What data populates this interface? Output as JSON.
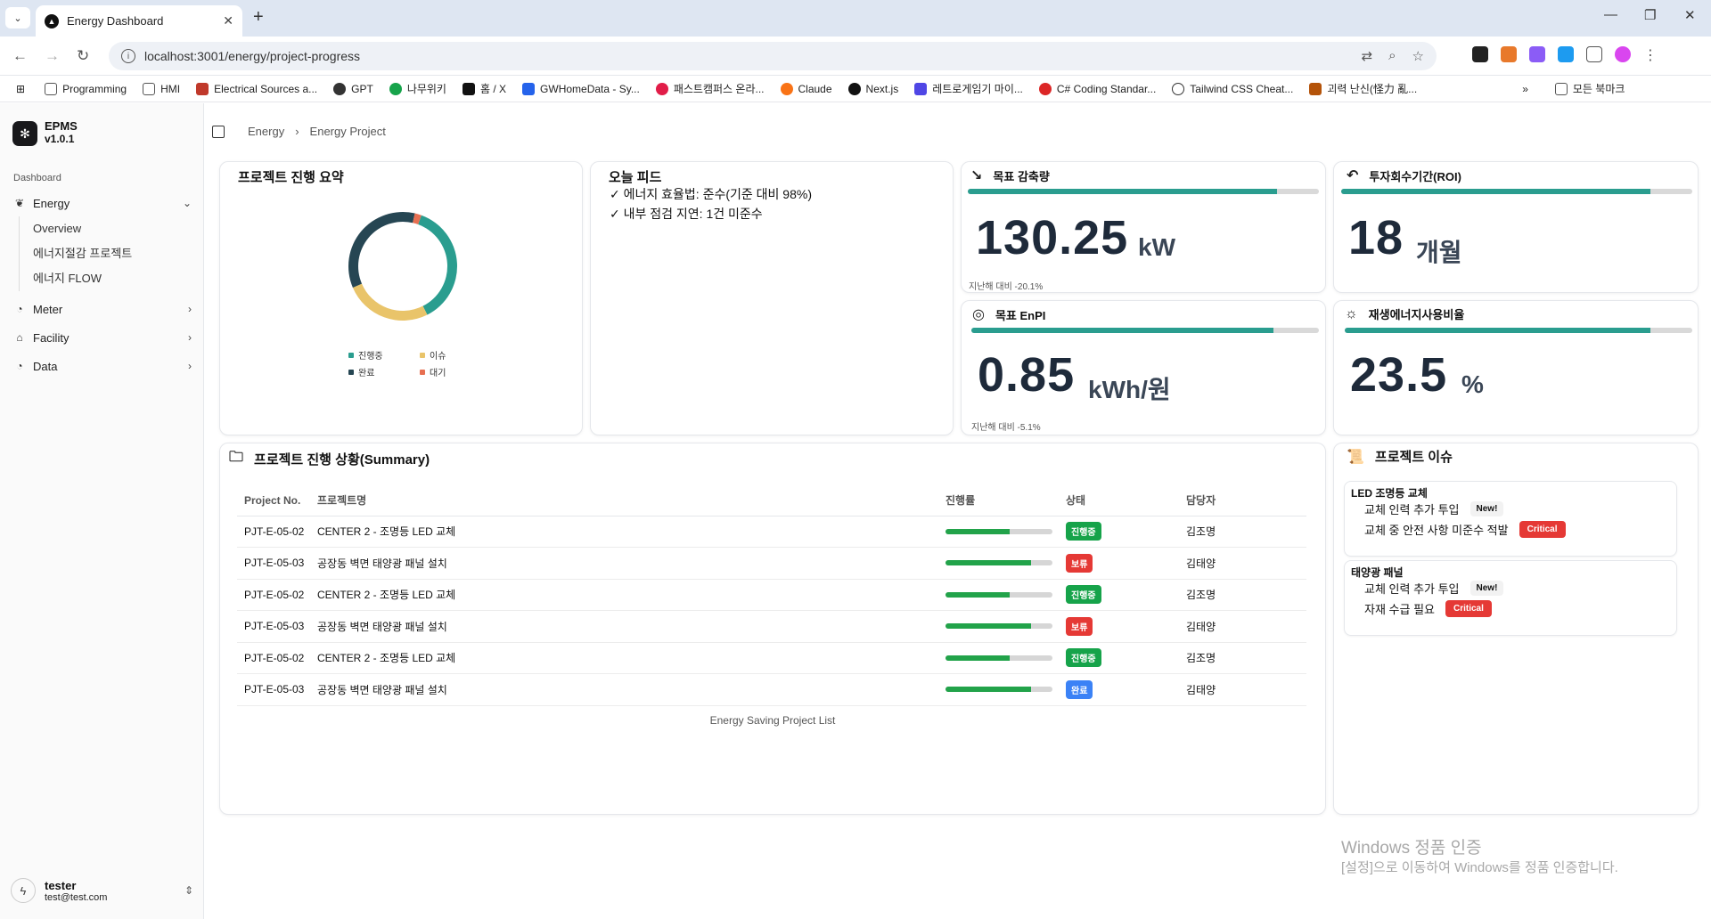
{
  "browser": {
    "tab_title": "Energy Dashboard",
    "url": "localhost:3001/energy/project-progress",
    "bookmarks": [
      "Programming",
      "HMI",
      "Electrical Sources a...",
      "GPT",
      "나무위키",
      "홈 / X",
      "GWHomeData - Sy...",
      "패스트캠퍼스 온라...",
      "Claude",
      "Next.js",
      "레트로게임기 마이...",
      "C# Coding Standar...",
      "Tailwind CSS Cheat...",
      "괴력 난신(怪力 亂..."
    ],
    "all_bookmarks": "모든 북마크"
  },
  "sidebar": {
    "app_name": "EPMS",
    "version": "v1.0.1",
    "group_label": "Dashboard",
    "energy": "Energy",
    "energy_items": [
      "Overview",
      "에너지절감 프로젝트",
      "에너지 FLOW"
    ],
    "meter": "Meter",
    "facility": "Facility",
    "data": "Data",
    "user_name": "tester",
    "user_email": "test@test.com"
  },
  "breadcrumb": {
    "level1": "Energy",
    "level2": "Energy Project"
  },
  "summary_card": {
    "title": "프로젝트 진행 요약",
    "legend": [
      "진행중",
      "이슈",
      "완료",
      "대기"
    ],
    "colors": {
      "progress": "#2a9d8f",
      "issue": "#e9c46a",
      "done": "#264653",
      "wait": "#e76f51"
    },
    "chart_data": {
      "type": "pie",
      "categories": [
        "진행중",
        "이슈",
        "완료",
        "대기"
      ],
      "values": [
        37,
        26,
        35,
        2
      ]
    }
  },
  "feed": {
    "title": "오늘 피드",
    "items": [
      "에너지 효율법: 준수(기준 대비 98%)",
      "내부 점검 지연: 1건 미준수"
    ]
  },
  "kpis": {
    "reduction": {
      "title": "목표 감축량",
      "value": "130.25",
      "unit": "kW",
      "progress": 0.88,
      "sub": "지난해 대비 -20.1%"
    },
    "roi": {
      "title": "투자회수기간(ROI)",
      "value": "18",
      "unit": "개월",
      "progress": 0.88
    },
    "enpi": {
      "title": "목표 EnPI",
      "value": "0.85",
      "unit": "kWh/원",
      "progress": 0.87,
      "sub": "지난해 대비 -5.1%"
    },
    "renewable": {
      "title": "재생에너지사용비율",
      "value": "23.5",
      "unit": "%",
      "progress": 0.88
    }
  },
  "project_table": {
    "title": "프로젝트 진행 상황(Summary)",
    "headers": [
      "Project No.",
      "프로젝트명",
      "진행률",
      "상태",
      "담당자"
    ],
    "rows": [
      {
        "no": "PJT-E-05-02",
        "name": "CENTER 2 - 조명등 LED 교체",
        "progress": 0.6,
        "status": "진행중",
        "status_color": "#16a34a",
        "owner": "김조명"
      },
      {
        "no": "PJT-E-05-03",
        "name": "공장동 벽면 태양광 패널 설치",
        "progress": 0.8,
        "status": "보류",
        "status_color": "#e53935",
        "owner": "김태양"
      },
      {
        "no": "PJT-E-05-02",
        "name": "CENTER 2 - 조명등 LED 교체",
        "progress": 0.6,
        "status": "진행중",
        "status_color": "#16a34a",
        "owner": "김조명"
      },
      {
        "no": "PJT-E-05-03",
        "name": "공장동 벽면 태양광 패널 설치",
        "progress": 0.8,
        "status": "보류",
        "status_color": "#e53935",
        "owner": "김태양"
      },
      {
        "no": "PJT-E-05-02",
        "name": "CENTER 2 - 조명등 LED 교체",
        "progress": 0.6,
        "status": "진행중",
        "status_color": "#16a34a",
        "owner": "김조명"
      },
      {
        "no": "PJT-E-05-03",
        "name": "공장동 벽면 태양광 패널 설치",
        "progress": 0.8,
        "status": "완료",
        "status_color": "#3b82f6",
        "owner": "김태양"
      }
    ],
    "caption": "Energy Saving Project List"
  },
  "issues": {
    "title": "프로젝트 이슈",
    "groups": [
      {
        "title": "LED 조명등 교체",
        "lines": [
          {
            "text": "교체 인력 추가 투입",
            "tag": "New!"
          },
          {
            "text": "교체 중 안전 사항 미준수 적발",
            "tag": "Critical"
          }
        ]
      },
      {
        "title": "태양광 패널",
        "lines": [
          {
            "text": "교체 인력 추가 투입",
            "tag": "New!"
          },
          {
            "text": "자재 수급 필요",
            "tag": "Critical"
          }
        ]
      }
    ]
  },
  "watermark": {
    "line1": "Windows 정품 인증",
    "line2": "[설정]으로 이동하여 Windows를 정품 인증합니다."
  }
}
